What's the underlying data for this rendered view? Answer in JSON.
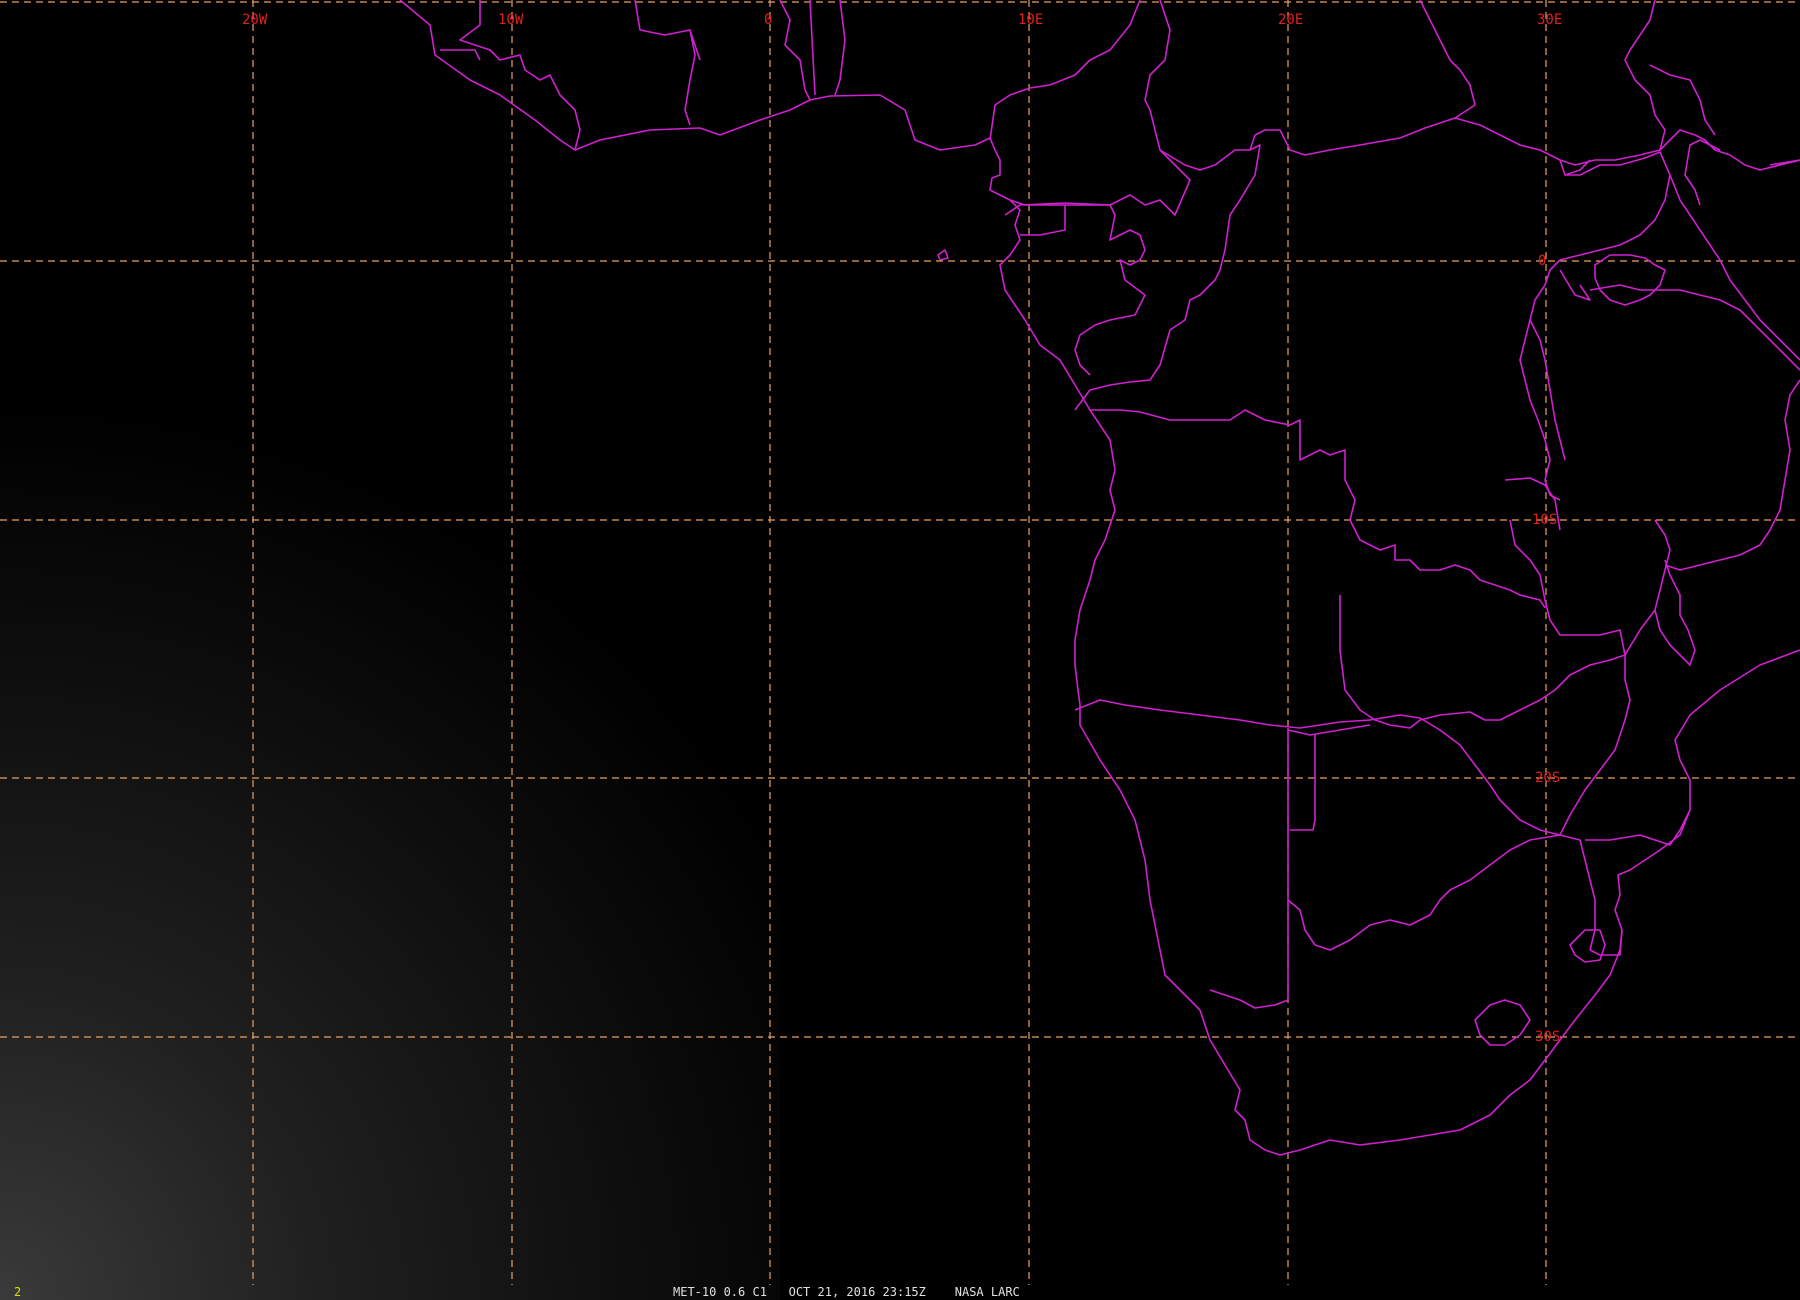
{
  "map": {
    "projection_note": "",
    "grid": {
      "longitudes": [
        "20W",
        "10W",
        "0",
        "10E",
        "20E",
        "30E"
      ],
      "latitudes": [
        "0",
        "10S",
        "20S",
        "30S"
      ]
    }
  },
  "status_bar": {
    "frame_number": "2",
    "caption": "MET-10 0.6 C1   OCT 21, 2016 23:15Z    NASA LARC"
  },
  "colors": {
    "background": "#000000",
    "grid_line": "#e8a060",
    "grid_label": "#e02020",
    "borders": "#d020d0",
    "status_text": "#e0e0e0",
    "frame_number": "#e0e000"
  }
}
